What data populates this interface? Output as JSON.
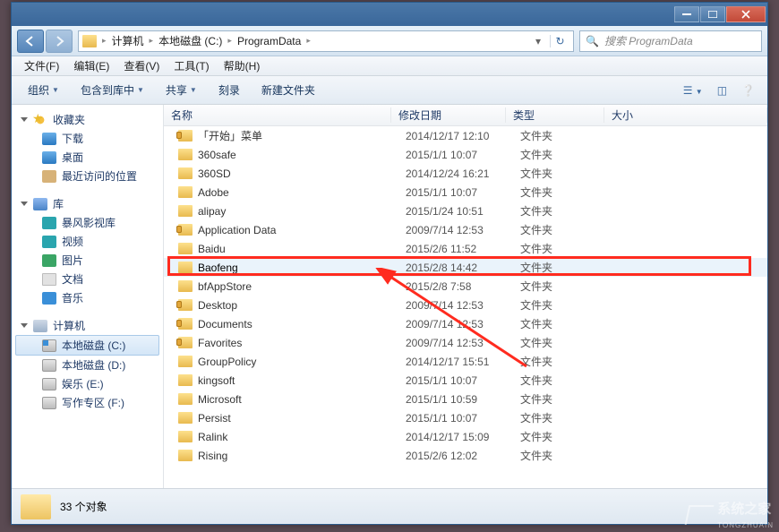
{
  "breadcrumb": {
    "c1": "计算机",
    "c2": "本地磁盘 (C:)",
    "c3": "ProgramData"
  },
  "search": {
    "placeholder": "搜索 ProgramData"
  },
  "menu": {
    "file": "文件(F)",
    "edit": "编辑(E)",
    "view": "查看(V)",
    "tools": "工具(T)",
    "help": "帮助(H)"
  },
  "toolbar": {
    "organize": "组织",
    "library": "包含到库中",
    "share": "共享",
    "burn": "刻录",
    "newfolder": "新建文件夹"
  },
  "sidebar": {
    "fav": "收藏夹",
    "fav_items": {
      "dl": "下载",
      "desk": "桌面",
      "recent": "最近访问的位置"
    },
    "lib": "库",
    "lib_items": {
      "bf": "暴风影视库",
      "vid": "视频",
      "pic": "图片",
      "doc": "文档",
      "mus": "音乐"
    },
    "comp": "计算机",
    "drives": {
      "c": "本地磁盘 (C:)",
      "d": "本地磁盘 (D:)",
      "e": "娱乐 (E:)",
      "f": "写作专区 (F:)"
    }
  },
  "columns": {
    "name": "名称",
    "date": "修改日期",
    "type": "类型",
    "size": "大小"
  },
  "type_folder": "文件夹",
  "rows": [
    {
      "name": "「开始」菜单",
      "date": "2014/12/17 12:10",
      "locked": true
    },
    {
      "name": "360safe",
      "date": "2015/1/1 10:07",
      "locked": false
    },
    {
      "name": "360SD",
      "date": "2014/12/24 16:21",
      "locked": false
    },
    {
      "name": "Adobe",
      "date": "2015/1/1 10:07",
      "locked": false
    },
    {
      "name": "alipay",
      "date": "2015/1/24 10:51",
      "locked": false
    },
    {
      "name": "Application Data",
      "date": "2009/7/14 12:53",
      "locked": true
    },
    {
      "name": "Baidu",
      "date": "2015/2/6 11:52",
      "locked": false
    },
    {
      "name": "Baofeng",
      "date": "2015/2/8 14:42",
      "locked": false,
      "highlight": true
    },
    {
      "name": "bfAppStore",
      "date": "2015/2/8 7:58",
      "locked": false
    },
    {
      "name": "Desktop",
      "date": "2009/7/14 12:53",
      "locked": true
    },
    {
      "name": "Documents",
      "date": "2009/7/14 12:53",
      "locked": true
    },
    {
      "name": "Favorites",
      "date": "2009/7/14 12:53",
      "locked": true
    },
    {
      "name": "GroupPolicy",
      "date": "2014/12/17 15:51",
      "locked": false
    },
    {
      "name": "kingsoft",
      "date": "2015/1/1 10:07",
      "locked": false
    },
    {
      "name": "Microsoft",
      "date": "2015/1/1 10:59",
      "locked": false
    },
    {
      "name": "Persist",
      "date": "2015/1/1 10:07",
      "locked": false
    },
    {
      "name": "Ralink",
      "date": "2014/12/17 15:09",
      "locked": false
    },
    {
      "name": "Rising",
      "date": "2015/2/6 12:02",
      "locked": false
    }
  ],
  "status": {
    "count": "33 个对象"
  },
  "watermark": {
    "text": "系统之家",
    "url": "TONGZHUAIN"
  }
}
